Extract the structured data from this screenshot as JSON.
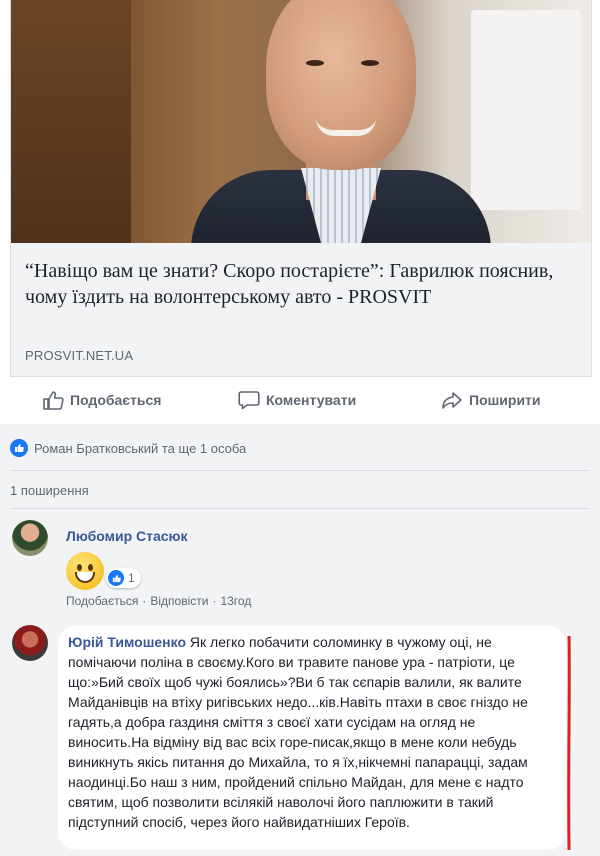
{
  "link_card": {
    "title": "“Навіщо вам це знати? Скоро постарієте”: Гаврилюк пояснив, чому їздить на волонтерському авто - PROSVIT",
    "domain": "PROSVIT.NET.UA"
  },
  "actions": {
    "like_label": "Подобається",
    "comment_label": "Коментувати",
    "share_label": "Поширити"
  },
  "reactions_text": "Роман Братковський та ще 1 особа",
  "shares_text": "1 поширення",
  "comments": [
    {
      "author": "Любомир Стасюк",
      "reaction_count": "1",
      "like_link": "Подобається",
      "reply_link": "Відповісти",
      "separator": "·",
      "time": "13год"
    },
    {
      "author": "Юрій Тимошенко",
      "text": "Як легко побачити соломинку в чужому оці, не помічаючи поліна в своєму.Кого ви травите панове ура - патріоти, це що:»Бий своїх щоб чужі боялись»?Ви б так сєпарів валили, як валите Майданівців на втіху ригівських недо...ків.Навіть птахи в своє гніздо не гадять,а добра газдиня сміття з своєї хати сусідам на огляд не виносить.На відміну від вас всіх горе-писак,якщо в мене коли небудь виникнуть якісь питання до Михайла, то я їх,нікчемні папарацці, задам наодинці.Бо наш з ним, пройдений спільно Майдан, для мене є надто святим, щоб позволити всілякій наволочі його паплюжити в такий підступний спосіб, через його найвидатніших Героїв."
    }
  ],
  "colors": {
    "link_blue": "#385898",
    "like_blue": "#1877f2",
    "annotation_red": "#e0201c"
  }
}
